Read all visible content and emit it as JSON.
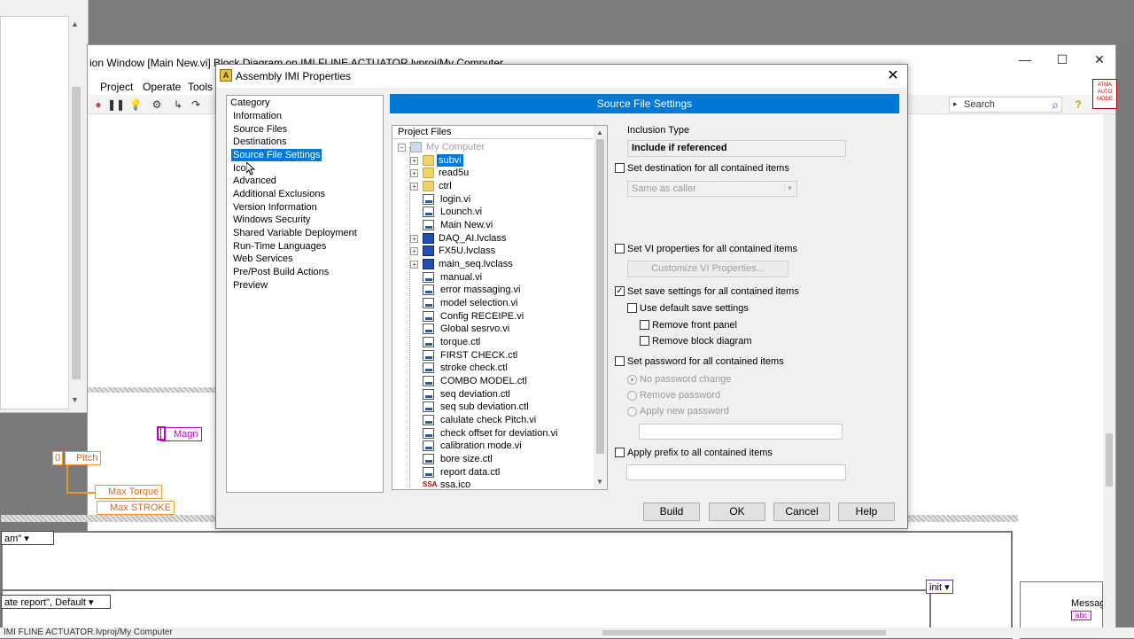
{
  "background": {
    "window_title": "ion Window [Main New.vi] Block Diagram on IMI FLINE ACTUATOR.lvproj/My Computer",
    "menu": [
      "Project",
      "Operate",
      "Tools"
    ],
    "search_placeholder": "Search",
    "badge": "ATMA AUTO MODE",
    "diagram_tags": {
      "magn": "Magn",
      "pitch": "Pitch",
      "zero": "0",
      "max_torque": "Max Torque",
      "max_stroke": "Max STROKE",
      "case1": "am\"",
      "case2": "ate report\", Default",
      "init": "init",
      "messag": "Messag",
      "abc": "abc"
    },
    "status_text": "IMI FLINE ACTUATOR.lvproj/My Computer"
  },
  "dialog": {
    "title": "Assembly IMI Properties",
    "icon_text": "A",
    "category_header": "Category",
    "categories": [
      "Information",
      "Source Files",
      "Destinations",
      "Source File Settings",
      "Icon",
      "Advanced",
      "Additional Exclusions",
      "Version Information",
      "Windows Security",
      "Shared Variable Deployment",
      "Run-Time Languages",
      "Web Services",
      "Pre/Post Build Actions",
      "Preview"
    ],
    "selected_category": "Source File Settings",
    "section_title": "Source File Settings",
    "tree_header": "Project Files",
    "tree": [
      {
        "label": "My Computer",
        "type": "computer",
        "state": "dim"
      },
      {
        "label": "subvi",
        "type": "folder",
        "expander": "+",
        "state": "selected"
      },
      {
        "label": "read5u",
        "type": "folder",
        "expander": "+"
      },
      {
        "label": "ctrl",
        "type": "folder",
        "expander": "+"
      },
      {
        "label": "login.vi",
        "type": "vi"
      },
      {
        "label": "Lounch.vi",
        "type": "vi"
      },
      {
        "label": "Main New.vi",
        "type": "vi"
      },
      {
        "label": "DAQ_AI.lvclass",
        "type": "class",
        "expander": "+"
      },
      {
        "label": "FX5U.lvclass",
        "type": "class",
        "expander": "+"
      },
      {
        "label": "main_seq.lvclass",
        "type": "class",
        "expander": "+"
      },
      {
        "label": "manual.vi",
        "type": "vi"
      },
      {
        "label": "error massaging.vi",
        "type": "vi"
      },
      {
        "label": "model selection.vi",
        "type": "vi"
      },
      {
        "label": "Config RECEIPE.vi",
        "type": "vi"
      },
      {
        "label": "Global sesrvo.vi",
        "type": "vi"
      },
      {
        "label": "torque.ctl",
        "type": "vi"
      },
      {
        "label": "FIRST CHECK.ctl",
        "type": "vi"
      },
      {
        "label": "stroke check.ctl",
        "type": "vi"
      },
      {
        "label": "COMBO MODEL.ctl",
        "type": "vi"
      },
      {
        "label": "seq deviation.ctl",
        "type": "vi"
      },
      {
        "label": "seq  sub deviation.ctl",
        "type": "vi"
      },
      {
        "label": "calulate check Pitch.vi",
        "type": "vi"
      },
      {
        "label": "check offset for deviation.vi",
        "type": "vi"
      },
      {
        "label": "calibration mode.vi",
        "type": "vi"
      },
      {
        "label": "bore size.ctl",
        "type": "vi"
      },
      {
        "label": "report data.ctl",
        "type": "vi"
      },
      {
        "label": "ssa.ico",
        "type": "ssa",
        "icon_text": "SSA"
      }
    ],
    "settings": {
      "inclusion_type_label": "Inclusion Type",
      "inclusion_type_value": "Include if referenced",
      "set_destination": {
        "label": "Set destination for all contained items",
        "checked": false
      },
      "destination_value": "Same as caller",
      "set_vi_properties": {
        "label": "Set VI properties for all contained items",
        "checked": false
      },
      "customize_button": "Customize VI Properties...",
      "set_save_settings": {
        "label": "Set save settings for all contained items",
        "checked": true
      },
      "use_default_save": {
        "label": "Use default save settings",
        "checked": false
      },
      "remove_front_panel": {
        "label": "Remove front panel",
        "checked": false
      },
      "remove_block_diagram": {
        "label": "Remove block diagram",
        "checked": false
      },
      "set_password": {
        "label": "Set password for all contained items",
        "checked": false
      },
      "password_options": [
        "No password change",
        "Remove password",
        "Apply new password"
      ],
      "password_selected": "No password change",
      "apply_prefix": {
        "label": "Apply prefix to all contained items",
        "checked": false
      }
    },
    "buttons": {
      "build": "Build",
      "ok": "OK",
      "cancel": "Cancel",
      "help": "Help"
    }
  },
  "colors": {
    "accent": "#0078d7",
    "wire": "#e89a28",
    "pink": "#c000c0"
  }
}
